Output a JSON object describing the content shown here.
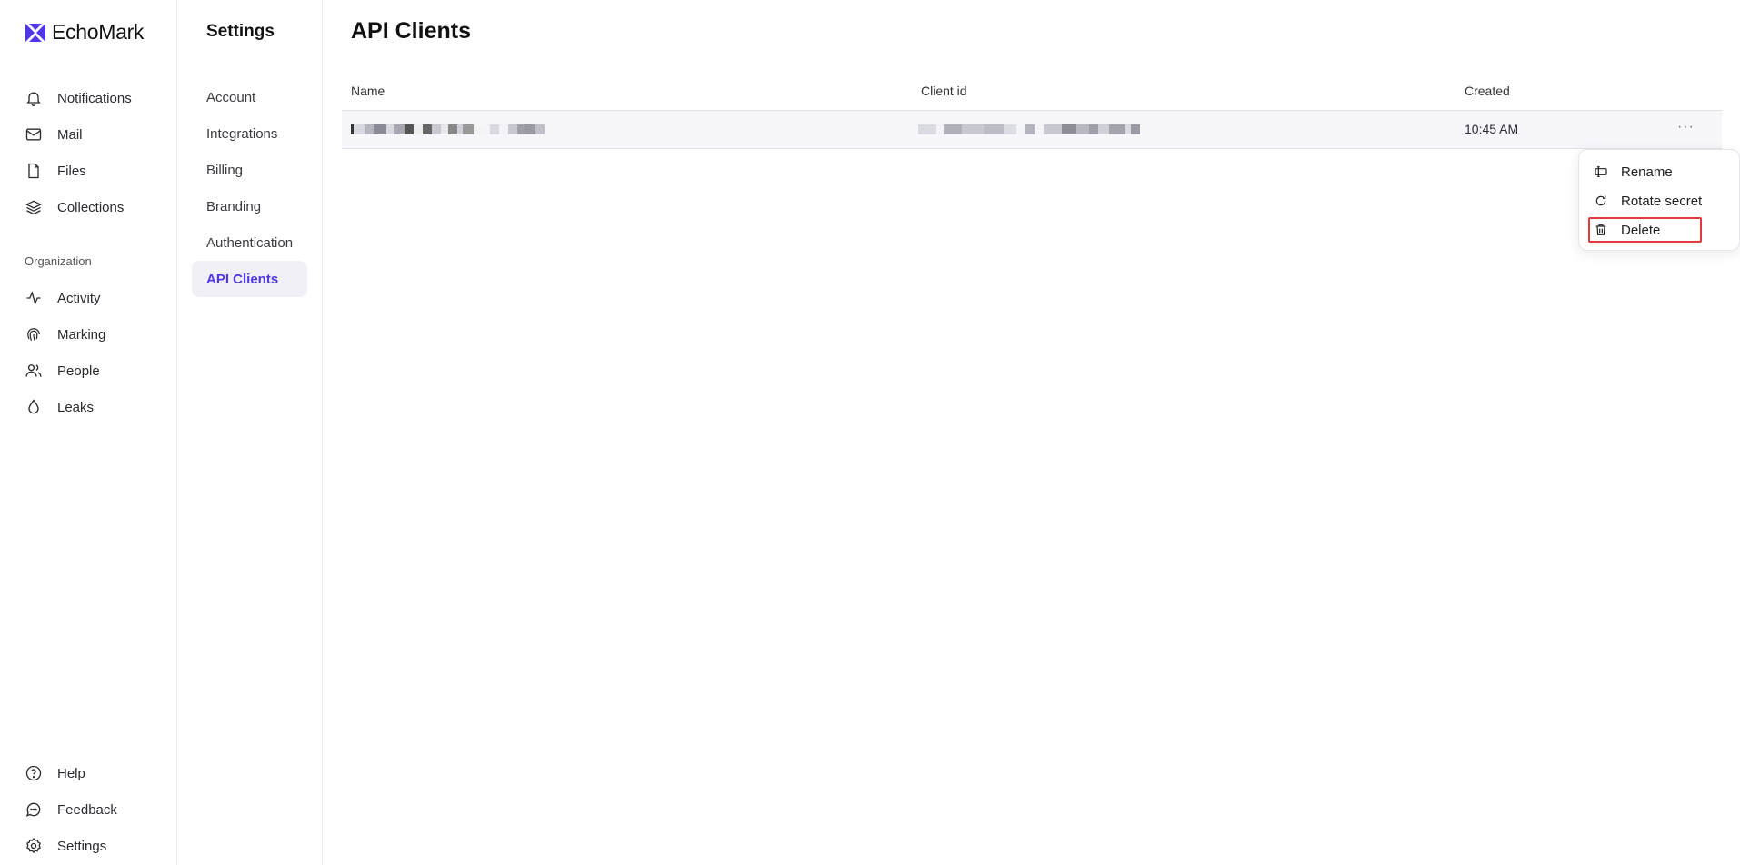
{
  "brand": {
    "name": "EchoMark",
    "accent": "#4f36e6"
  },
  "nav": {
    "items": [
      {
        "label": "Notifications",
        "icon": "bell-icon"
      },
      {
        "label": "Mail",
        "icon": "mail-icon"
      },
      {
        "label": "Files",
        "icon": "file-icon"
      },
      {
        "label": "Collections",
        "icon": "layers-icon"
      }
    ],
    "section_label": "Organization",
    "org_items": [
      {
        "label": "Activity",
        "icon": "activity-icon"
      },
      {
        "label": "Marking",
        "icon": "fingerprint-icon"
      },
      {
        "label": "People",
        "icon": "people-icon"
      },
      {
        "label": "Leaks",
        "icon": "droplet-icon"
      }
    ],
    "bottom_items": [
      {
        "label": "Help",
        "icon": "help-icon"
      },
      {
        "label": "Feedback",
        "icon": "chat-icon"
      },
      {
        "label": "Settings",
        "icon": "gear-icon"
      }
    ]
  },
  "settings": {
    "title": "Settings",
    "items": [
      "Account",
      "Integrations",
      "Billing",
      "Branding",
      "Authentication",
      "API Clients"
    ],
    "active": "API Clients"
  },
  "main": {
    "title": "API Clients",
    "columns": [
      "Name",
      "Client id",
      "Created"
    ],
    "rows": [
      {
        "name": "[redacted]",
        "client_id": "[redacted]",
        "created": "10:45 AM"
      }
    ],
    "row_more": "···"
  },
  "menu": {
    "items": [
      {
        "label": "Rename",
        "icon": "rename-icon"
      },
      {
        "label": "Rotate secret",
        "icon": "rotate-icon"
      },
      {
        "label": "Delete",
        "icon": "trash-icon"
      }
    ],
    "highlight_color": "#e0393e"
  }
}
